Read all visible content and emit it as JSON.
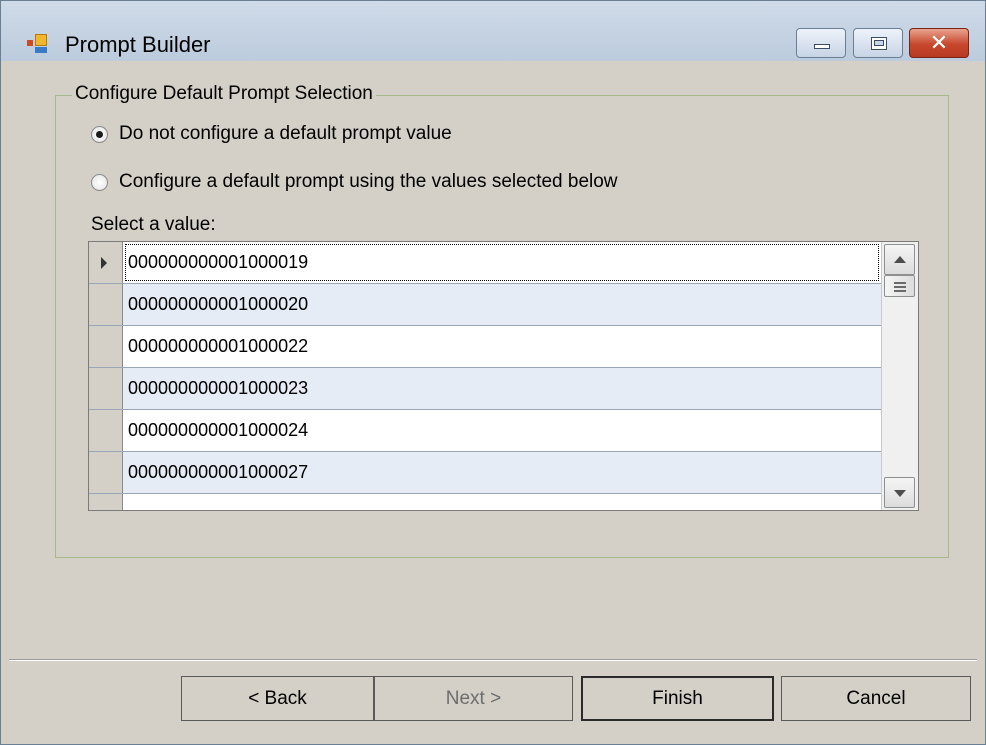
{
  "window": {
    "title": "Prompt Builder",
    "controls": {
      "minimize": "minimize",
      "maximize": "maximize",
      "close": "✕"
    }
  },
  "group": {
    "legend": "Configure Default Prompt Selection",
    "options": [
      {
        "label": "Do not configure a default prompt value",
        "checked": true
      },
      {
        "label": "Configure a default prompt using the values selected below",
        "checked": false
      }
    ],
    "select_label": "Select a value:"
  },
  "grid": {
    "rows": [
      "000000000001000019",
      "000000000001000020",
      "000000000001000022",
      "000000000001000023",
      "000000000001000024",
      "000000000001000027"
    ],
    "current_row": 0
  },
  "buttons": {
    "back": "< Back",
    "next": "Next >",
    "finish": "Finish",
    "cancel": "Cancel"
  },
  "colors": {
    "alt_row": "#e6ecf5",
    "group_border": "#a8b88a",
    "close_button": "#c7472c"
  }
}
